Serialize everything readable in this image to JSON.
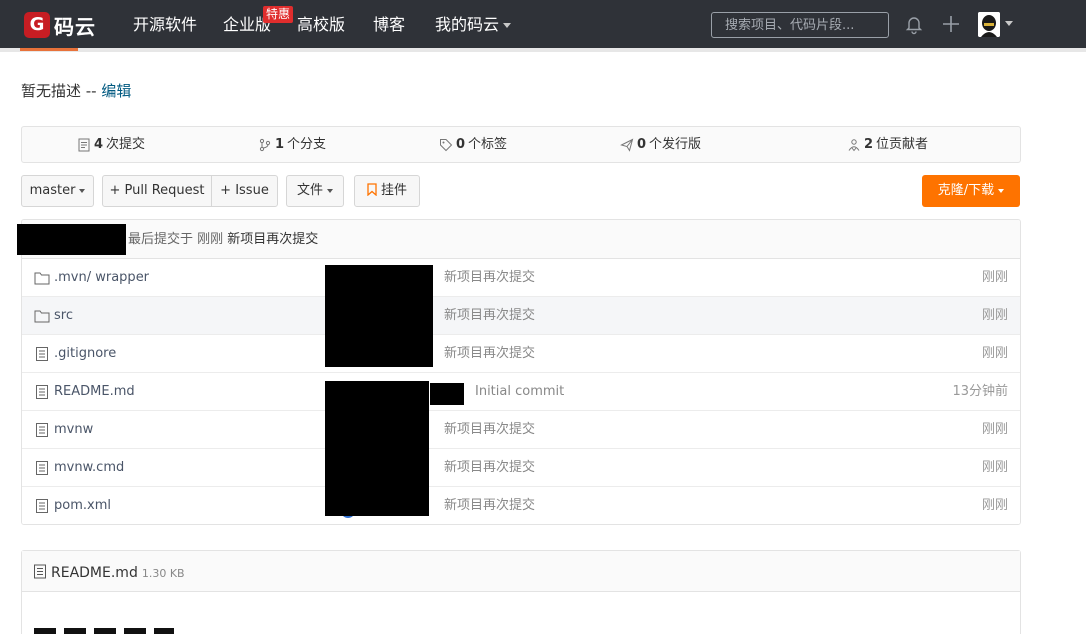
{
  "nav": {
    "logo_mark": "G",
    "logo_text": "码云",
    "items": [
      {
        "label": "开源软件"
      },
      {
        "label": "企业版"
      },
      {
        "label": "高校版"
      },
      {
        "label": "博客"
      },
      {
        "label": "我的码云"
      }
    ],
    "badge": "特惠",
    "search_placeholder": "搜索项目、代码片段..."
  },
  "description": {
    "text": "暂无描述 -- ",
    "edit_link": "编辑"
  },
  "stats": [
    {
      "icon": "commit-icon",
      "count": "4",
      "label": "次提交"
    },
    {
      "icon": "branch-icon",
      "count": "1",
      "label": "个分支"
    },
    {
      "icon": "tag-icon",
      "count": "0",
      "label": "个标签"
    },
    {
      "icon": "release-icon",
      "count": "0",
      "label": "个发行版"
    },
    {
      "icon": "contributors-icon",
      "count": "2",
      "label": "位贡献者"
    }
  ],
  "toolbar": {
    "branch": "master",
    "pull_request": "+ Pull Request",
    "issue": "+ Issue",
    "files": "文件",
    "widget": "挂件",
    "clone": "克隆/下载"
  },
  "last_commit": {
    "prefix": "最后提交于 刚刚 ",
    "message": "新项目再次提交"
  },
  "files": [
    {
      "type": "folder",
      "name": ".mvn/ wrapper",
      "message": "新项目再次提交",
      "time": "刚刚"
    },
    {
      "type": "folder",
      "name": "src",
      "message": "新项目再次提交",
      "time": "刚刚"
    },
    {
      "type": "file",
      "name": ".gitignore",
      "message": "新项目再次提交",
      "time": "刚刚"
    },
    {
      "type": "file",
      "name": "README.md",
      "message": "Initial commit",
      "time": "13分钟前"
    },
    {
      "type": "file",
      "name": "mvnw",
      "message": "新项目再次提交",
      "time": "刚刚"
    },
    {
      "type": "file",
      "name": "mvnw.cmd",
      "message": "新项目再次提交",
      "time": "刚刚"
    },
    {
      "type": "file",
      "name": "pom.xml",
      "message": "新项目再次提交",
      "time": "刚刚"
    }
  ],
  "readme": {
    "title": "README.md",
    "size": "1.30 KB"
  },
  "colors": {
    "nav_bg": "#2f3238",
    "brand_red": "#c71d23",
    "clone_orange": "#fe7300",
    "link": "#005980"
  }
}
